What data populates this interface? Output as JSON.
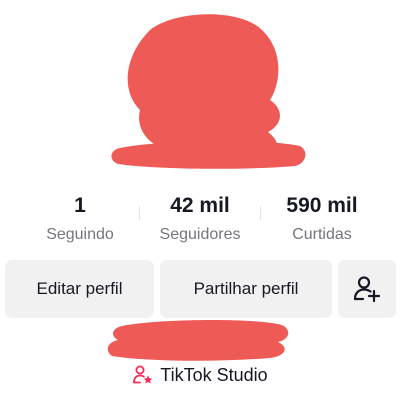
{
  "stats": {
    "following": {
      "value": "1",
      "label": "Seguindo"
    },
    "followers": {
      "value": "42 mil",
      "label": "Seguidores"
    },
    "likes": {
      "value": "590 mil",
      "label": "Curtidas"
    }
  },
  "actions": {
    "edit_label": "Editar perfil",
    "share_label": "Partilhar perfil",
    "add_user_icon": "person-add-icon"
  },
  "studio": {
    "label": "TikTok Studio",
    "icon": "person-star-icon"
  },
  "colors": {
    "redaction": "#ee5a55",
    "button_bg": "#f1f1f2",
    "text_primary": "#161823",
    "text_secondary": "#75767c",
    "accent": "#fe2c55"
  }
}
